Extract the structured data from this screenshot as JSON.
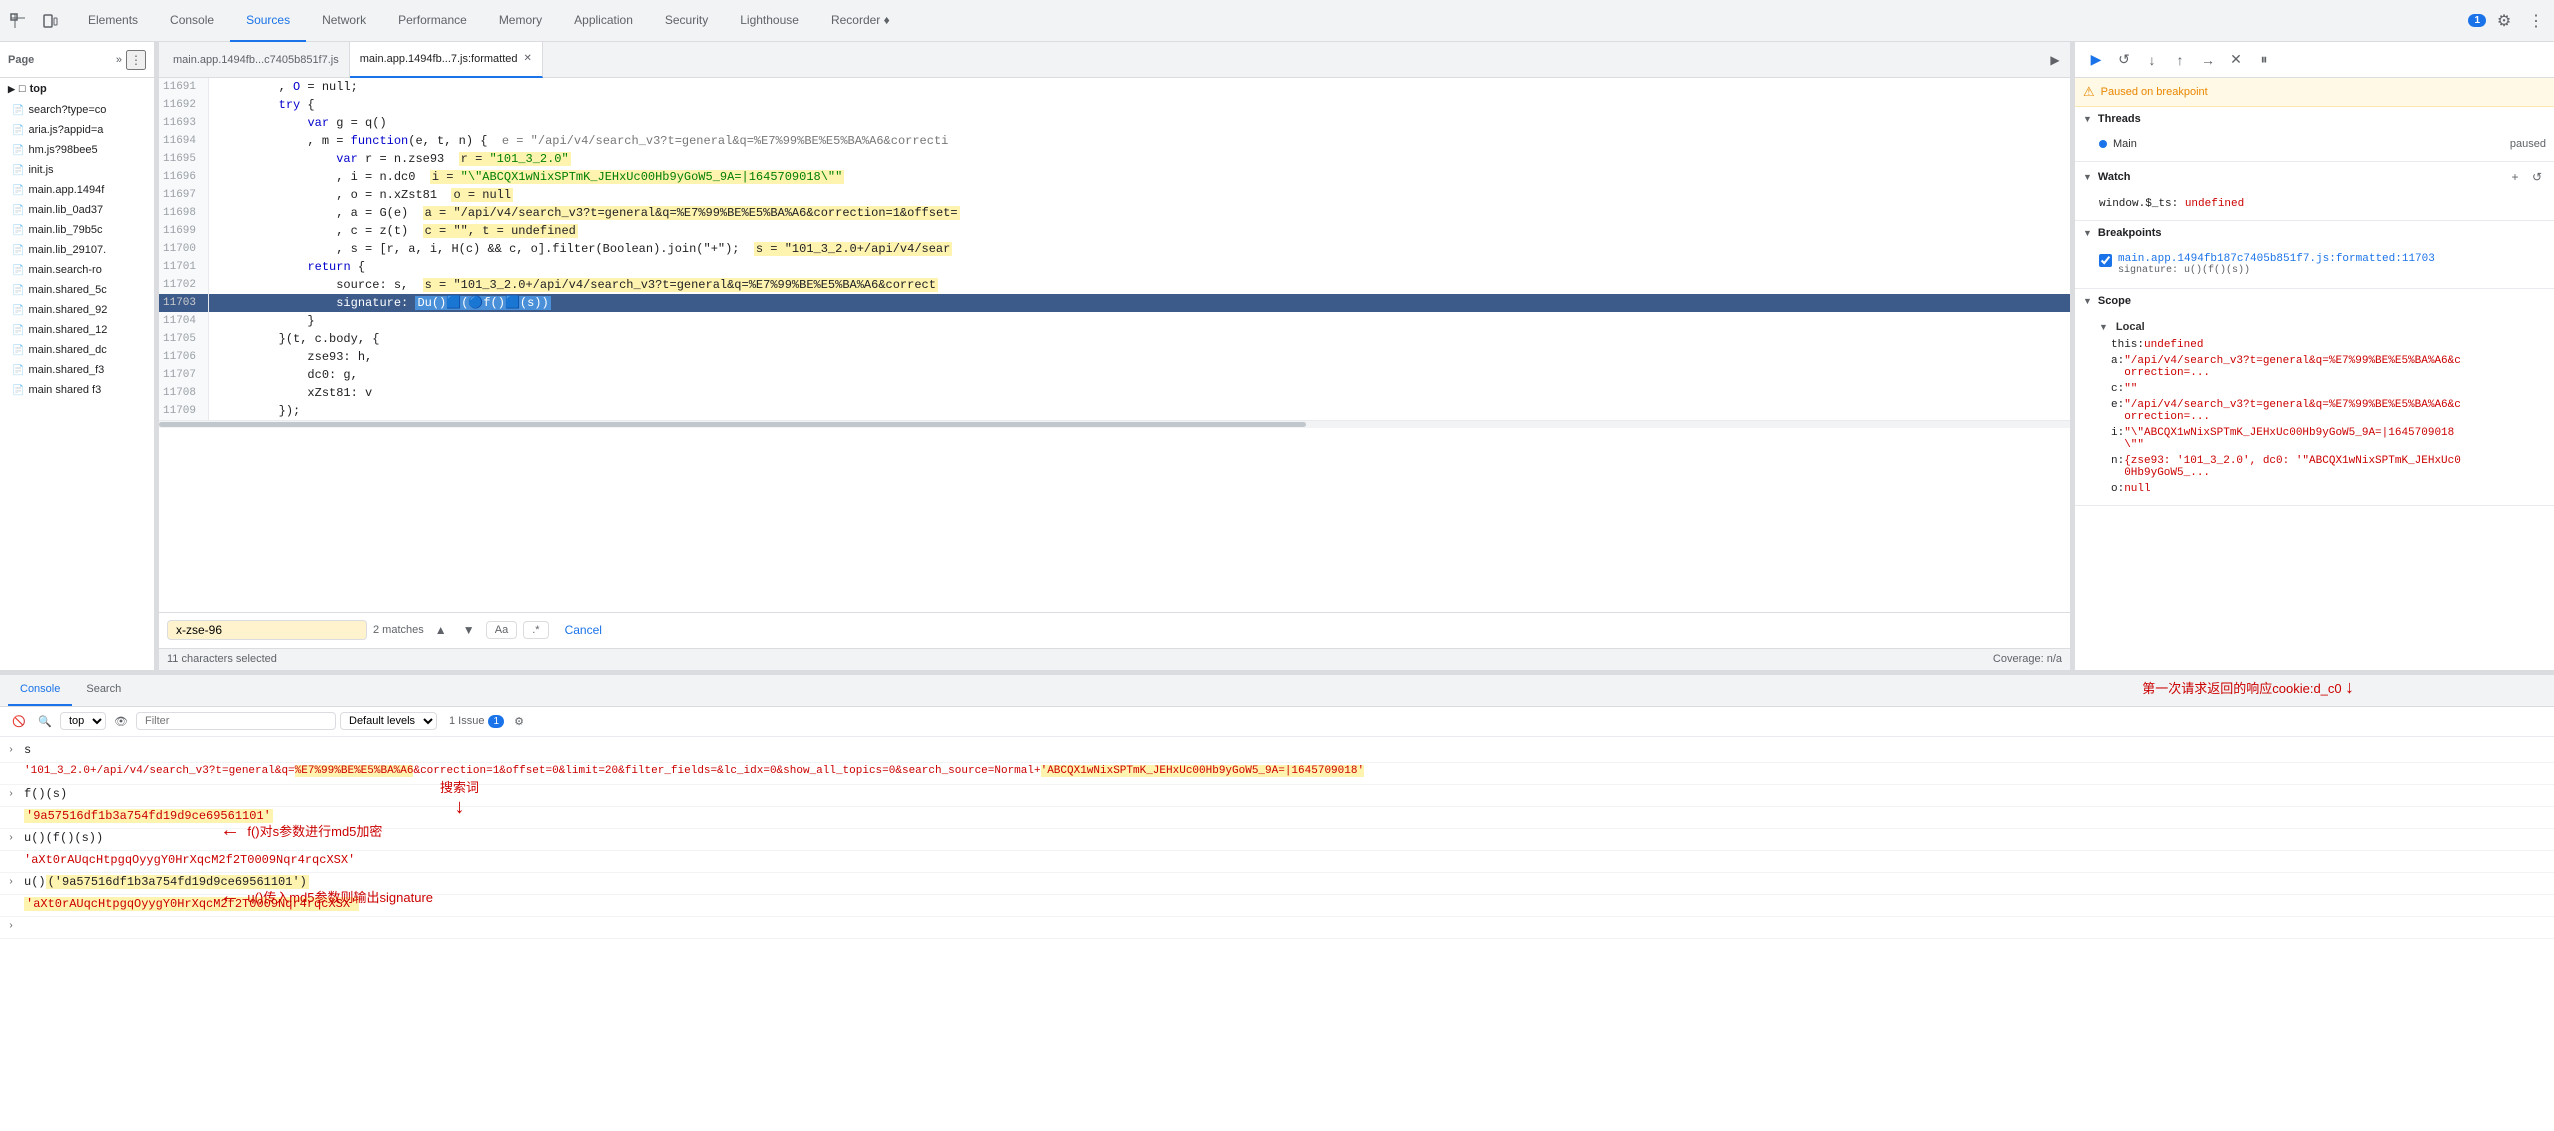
{
  "devtools": {
    "tabs": [
      {
        "label": "Elements",
        "active": false
      },
      {
        "label": "Console",
        "active": false
      },
      {
        "label": "Sources",
        "active": true
      },
      {
        "label": "Network",
        "active": false
      },
      {
        "label": "Performance",
        "active": false
      },
      {
        "label": "Memory",
        "active": false
      },
      {
        "label": "Application",
        "active": false
      },
      {
        "label": "Security",
        "active": false
      },
      {
        "label": "Lighthouse",
        "active": false
      },
      {
        "label": "Recorder ♦",
        "active": false
      }
    ],
    "notification_count": "1"
  },
  "file_panel": {
    "title": "Page",
    "tree": [
      {
        "label": "top",
        "type": "folder",
        "root": true
      },
      {
        "label": "search?type=co",
        "type": "file"
      },
      {
        "label": "aria.js?appid=a",
        "type": "file"
      },
      {
        "label": "hm.js?98bee5",
        "type": "file"
      },
      {
        "label": "init.js",
        "type": "file"
      },
      {
        "label": "main.app.1494f",
        "type": "file"
      },
      {
        "label": "main.lib_0ad37",
        "type": "file"
      },
      {
        "label": "main.lib_79b5c",
        "type": "file"
      },
      {
        "label": "main.lib_29107.",
        "type": "file"
      },
      {
        "label": "main.search-ro",
        "type": "file"
      },
      {
        "label": "main.shared_5c",
        "type": "file"
      },
      {
        "label": "main.shared_92",
        "type": "file"
      },
      {
        "label": "main.shared_12",
        "type": "file"
      },
      {
        "label": "main.shared_dc",
        "type": "file"
      },
      {
        "label": "main.shared_f3",
        "type": "file"
      },
      {
        "label": "main shared f3",
        "type": "file"
      }
    ]
  },
  "editor": {
    "tabs": [
      {
        "label": "main.app.1494fb...c7405b851f7.js",
        "active": false
      },
      {
        "label": "main.app.1494fb...7.js:formatted",
        "active": true
      }
    ],
    "lines": [
      {
        "num": "11691",
        "content": "        , O = null;"
      },
      {
        "num": "11692",
        "content": "        try {"
      },
      {
        "num": "11693",
        "content": "            var g = q()"
      },
      {
        "num": "11694",
        "content": "            , m = function(e, t, n) {  e = \"/api/v4/search_v3?t=general&q=%E7%99%BE%E5%BA%A6&correcti"
      },
      {
        "num": "11695",
        "content": "                var r = n.zse93  r = \"101_3_2.0\""
      },
      {
        "num": "11696",
        "content": "                , i = n.dc0   i = \"\\\"ABCQX1wNixSPTmK_JEHxUc00Hb9yGoW5_9A=|1645709018\\\"\""
      },
      {
        "num": "11697",
        "content": "                , o = n.xZst81  o = null"
      },
      {
        "num": "11698",
        "content": "                , a = G(e)   a = \"/api/v4/search_v3?t=general&q=%E7%99%BE%E5%BA%A6&correction=1&offset="
      },
      {
        "num": "11699",
        "content": "                , c = z(t)   c = \"\", t = undefined"
      },
      {
        "num": "11700",
        "content": "                , s = [r, a, i, H(c) && c, o].filter(Boolean).join(\"+\");  s = \"101_3_2.0+/api/v4/sear"
      },
      {
        "num": "11701",
        "content": "            return {"
      },
      {
        "num": "11702",
        "content": "                source: s,  s = \"101_3_2.0+/api/v4/search_v3?t=general&q=%E7%99%BE%E5%BA%A6&correct"
      },
      {
        "num": "11703",
        "content": "                signature: Du()D(Df()D(s))",
        "current": true
      },
      {
        "num": "11704",
        "content": "            }"
      },
      {
        "num": "11705",
        "content": "        }(t, c.body, {"
      },
      {
        "num": "11706",
        "content": "            zse93: h,"
      },
      {
        "num": "11707",
        "content": "            dc0: g,"
      },
      {
        "num": "11708",
        "content": "            xZst81: v"
      },
      {
        "num": "11709",
        "content": "        });"
      }
    ],
    "find": {
      "query": "x-zse-96",
      "match_count": "2 matches",
      "cancel_label": "Cancel",
      "status": "11 characters selected",
      "coverage": "Coverage: n/a"
    }
  },
  "debugger": {
    "paused_message": "Paused on breakpoint",
    "sections": {
      "threads": {
        "label": "Threads",
        "items": [
          {
            "label": "Main",
            "status": "paused"
          }
        ]
      },
      "watch": {
        "label": "Watch",
        "items": [
          {
            "key": "window.$_ts:",
            "value": "undefined"
          }
        ]
      },
      "breakpoints": {
        "label": "Breakpoints",
        "items": [
          {
            "file": "main.app.1494fb187c7405b851f7.js:formatted:11703",
            "expr": "signature: u()(f()(s))"
          }
        ]
      },
      "scope": {
        "label": "Scope",
        "local_label": "Local",
        "vars": [
          {
            "key": "this:",
            "value": "undefined"
          },
          {
            "key": "a:",
            "value": "\"/api/v4/search_v3?t=general&q=%E7%99%BE%E5%BA%A6&correction=..."
          },
          {
            "key": "c:",
            "value": "\"\""
          },
          {
            "key": "e:",
            "value": "\"/api/v4/search_v3?t=general&q=%E7%99%BE%E5%BA%A6&correction=..."
          },
          {
            "key": "i:",
            "value": "\"\\\"ABCQX1wNixSPTmK_JEHxUc00Hb9yGoW5_9A=|1645709018\\\"\""
          },
          {
            "key": "n:",
            "value": "{zse93: '101_3_2.0', dc0: '\"ABCQX1wNixSPTmK_JEHxUc00Hb9yGoW5_..."
          },
          {
            "key": "o:",
            "value": "null"
          }
        ]
      }
    }
  },
  "console": {
    "tabs": [
      "Console",
      "Search"
    ],
    "active_tab": "Console",
    "toolbar": {
      "context": "top",
      "filter_placeholder": "Filter",
      "log_level": "Default levels",
      "issue_count": "1 Issue",
      "issue_badge": "1"
    },
    "entries": [
      {
        "type": "input",
        "text": "s"
      },
      {
        "type": "output",
        "text": "'101_3_2.0+/api/v4/search_v3?t=general&q=%E7%99%BE%E5%BA%A6&correction=1&offset=0&limit=20&filter_fields=&lc_idx=0&show_all_topics=0&search_source=Normal+'ABCQX1wNixSPTmK_JEHxUc00Hb9yGoW5_9A=|1645709018'"
      },
      {
        "type": "input",
        "text": "f()(s)"
      },
      {
        "type": "output",
        "text": "'9a57516df1b3a754fd19d9ce69561101'"
      },
      {
        "type": "input",
        "text": "u()(f()(s))"
      },
      {
        "type": "output-plain",
        "text": "'aXt0rAUqcHtpgqOyygY0HrXqcM2f2T0009Nqr4rqcXSX'"
      },
      {
        "type": "input",
        "text": "u()('9a57516df1b3a754fd19d9ce69561101')"
      },
      {
        "type": "output-plain",
        "text": "'aXt0rAUqcHtpgqOyygY0HrXqcM2f2T0009Nqr4rqcXSX'"
      }
    ],
    "annotations": {
      "search_term": "搜索词",
      "md5": "f()对s参数进行md5加密",
      "cookie": "第一次请求返回的响应cookie:d_c0",
      "signature": "u()传入md5参数则输出signature"
    }
  }
}
